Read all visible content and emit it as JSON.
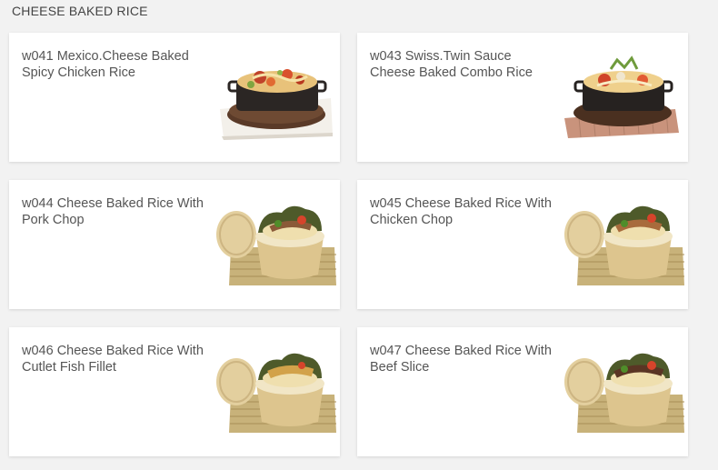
{
  "section": {
    "title": "CHEESE BAKED RICE"
  },
  "items": [
    {
      "name": "w041 Mexico.Cheese Baked Spicy Chicken Rice",
      "image": "cheese-baked-rice-skillet-photo"
    },
    {
      "name": "w043 Swiss.Twin Sauce Cheese Baked Combo Rice",
      "image": "cheese-baked-rice-skillet-photo"
    },
    {
      "name": "w044 Cheese Baked Rice With Pork Chop",
      "image": "steamer-rice-pork-chop-photo"
    },
    {
      "name": "w045 Cheese Baked Rice With Chicken Chop",
      "image": "steamer-rice-chicken-chop-photo"
    },
    {
      "name": "w046 Cheese Baked Rice With Cutlet Fish Fillet",
      "image": "steamer-rice-fish-fillet-photo"
    },
    {
      "name": "w047 Cheese Baked Rice With Beef Slice",
      "image": "steamer-rice-beef-slice-photo"
    }
  ]
}
